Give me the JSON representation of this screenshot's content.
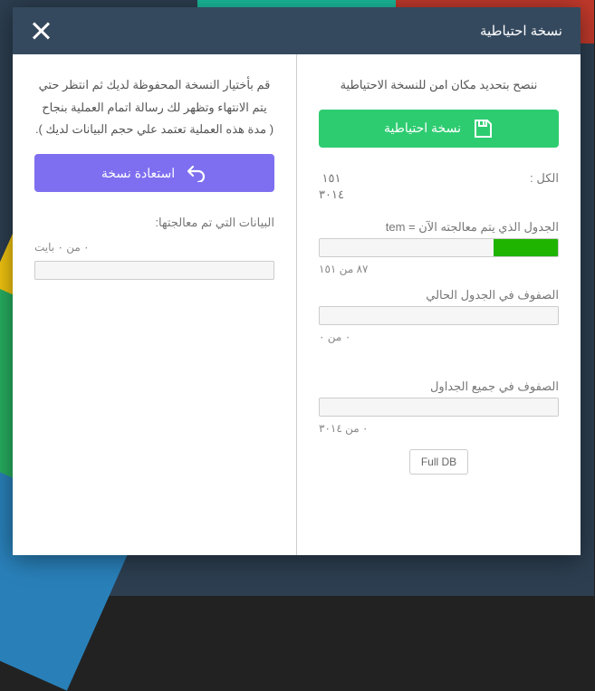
{
  "header": {
    "title": "نسخة احتياطية"
  },
  "right": {
    "hint": "ننصح بتحديد مكان امن للنسخة الاحتياطية",
    "btn": "نسخة احتياطية",
    "total_label": "الكل :",
    "total_a": "١٥١",
    "total_b": "٣٠١٤",
    "processing_label": "الجدول الذي يتم معالجته الآن = tem",
    "processing_sub": "٨٧ من ١٥١",
    "rows_current_label": "الصفوف في الجدول الحالي",
    "rows_current_sub": "٠ من ٠",
    "rows_all_label": "الصفوف في جميع الجداول",
    "rows_all_sub": "٠ من ٣٠١٤",
    "full_db": "Full DB",
    "progress_pct": 27
  },
  "left": {
    "hint_l1": "قم بأختيار النسخة المحفوظة لديك ثم انتظر حتي",
    "hint_l2": "يتم الانتهاء وتظهر لك رسالة اتمام العملية بنجاح",
    "hint_l3": "( مدة هذه العملية تعتمد علي حجم البيانات لديك ).",
    "btn": "استعادة نسخة",
    "processed_label": "البيانات التي تم معالجتها:",
    "processed_sub": "٠ من ٠ بايت"
  }
}
